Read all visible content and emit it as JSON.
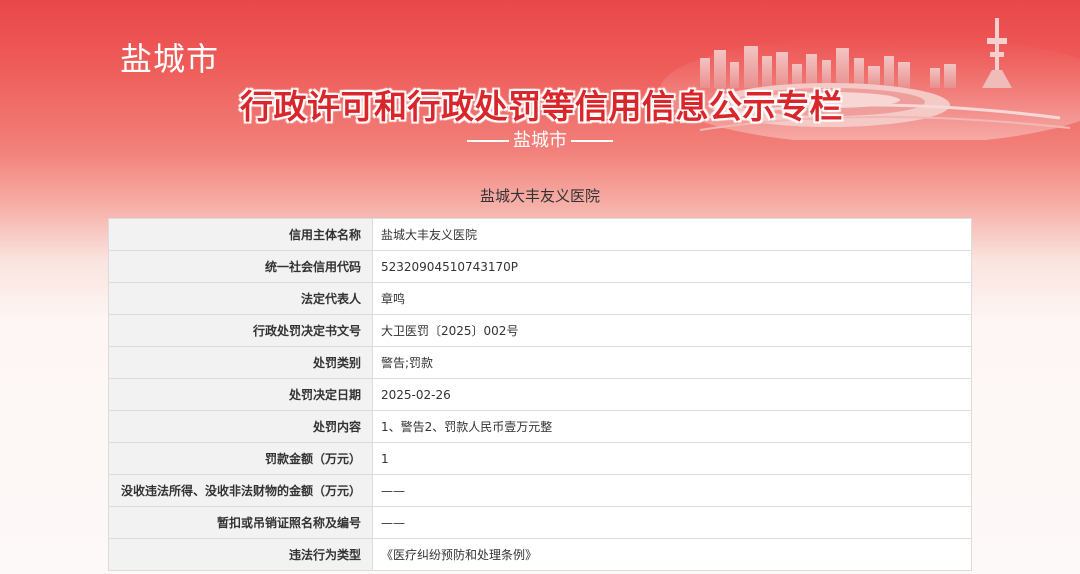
{
  "header": {
    "city": "盐城市",
    "title": "行政许可和行政处罚等信用信息公示专栏",
    "subtitle": "盐城市"
  },
  "org_name": "盐城大丰友义医院",
  "rows": [
    {
      "label": "信用主体名称",
      "value": "盐城大丰友义医院"
    },
    {
      "label": "统一社会信用代码",
      "value": "52320904510743170P"
    },
    {
      "label": "法定代表人",
      "value": "章鸣"
    },
    {
      "label": "行政处罚决定书文号",
      "value": "大卫医罚〔2025〕002号"
    },
    {
      "label": "处罚类别",
      "value": "警告;罚款"
    },
    {
      "label": "处罚决定日期",
      "value": "2025-02-26"
    },
    {
      "label": "处罚内容",
      "value": "1、警告2、罚款人民币壹万元整"
    },
    {
      "label": "罚款金额（万元）",
      "value": "1"
    },
    {
      "label": "没收违法所得、没收非法财物的金额（万元）",
      "value": "——"
    },
    {
      "label": "暂扣或吊销证照名称及编号",
      "value": "——"
    },
    {
      "label": "违法行为类型",
      "value": "《医疗纠纷预防和处理条例》"
    }
  ]
}
